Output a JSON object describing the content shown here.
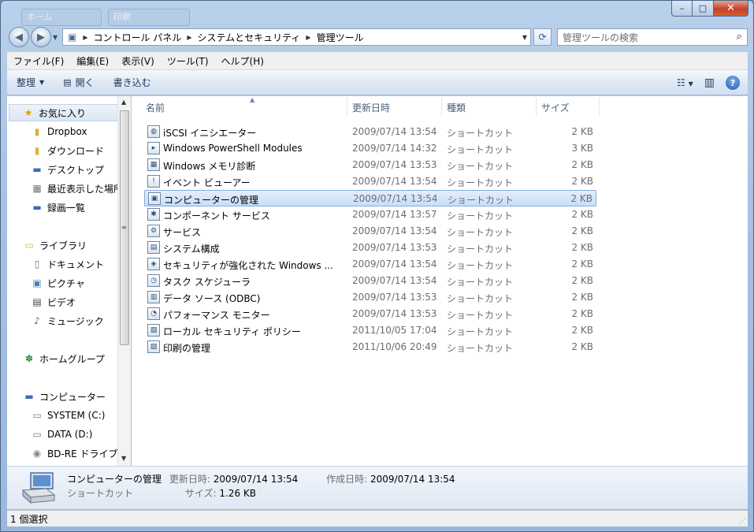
{
  "window": {
    "ghost_tabs": [
      "ホーム",
      "印刷"
    ],
    "caption": {
      "minimize": "–",
      "maximize": "□",
      "close": "✕"
    }
  },
  "address": {
    "crumbs": [
      "コントロール パネル",
      "システムとセキュリティ",
      "管理ツール"
    ],
    "search_placeholder": "管理ツールの検索"
  },
  "menu": [
    "ファイル(F)",
    "編集(E)",
    "表示(V)",
    "ツール(T)",
    "ヘルプ(H)"
  ],
  "commands": {
    "organize": "整理",
    "open": "開く",
    "burn": "書き込む"
  },
  "navigation": {
    "favorites": {
      "label": "お気に入り",
      "items": [
        "Dropbox",
        "ダウンロード",
        "デスクトップ",
        "最近表示した場所",
        "録画一覧"
      ]
    },
    "libraries": {
      "label": "ライブラリ",
      "items": [
        "ドキュメント",
        "ピクチャ",
        "ビデオ",
        "ミュージック"
      ]
    },
    "homegroup": {
      "label": "ホームグループ"
    },
    "computer": {
      "label": "コンピューター",
      "items": [
        "SYSTEM (C:)",
        "DATA (D:)",
        "BD-RE ドライブ"
      ]
    }
  },
  "columns": {
    "name": "名前",
    "date": "更新日時",
    "type": "種類",
    "size": "サイズ"
  },
  "files": [
    {
      "name": "iSCSI イニシエーター",
      "date": "2009/07/14 13:54",
      "type": "ショートカット",
      "size": "2 KB"
    },
    {
      "name": "Windows PowerShell Modules",
      "date": "2009/07/14 14:32",
      "type": "ショートカット",
      "size": "3 KB"
    },
    {
      "name": "Windows メモリ診断",
      "date": "2009/07/14 13:53",
      "type": "ショートカット",
      "size": "2 KB"
    },
    {
      "name": "イベント ビューアー",
      "date": "2009/07/14 13:54",
      "type": "ショートカット",
      "size": "2 KB"
    },
    {
      "name": "コンピューターの管理",
      "date": "2009/07/14 13:54",
      "type": "ショートカット",
      "size": "2 KB"
    },
    {
      "name": "コンポーネント サービス",
      "date": "2009/07/14 13:57",
      "type": "ショートカット",
      "size": "2 KB"
    },
    {
      "name": "サービス",
      "date": "2009/07/14 13:54",
      "type": "ショートカット",
      "size": "2 KB"
    },
    {
      "name": "システム構成",
      "date": "2009/07/14 13:53",
      "type": "ショートカット",
      "size": "2 KB"
    },
    {
      "name": "セキュリティが強化された Windows ...",
      "date": "2009/07/14 13:54",
      "type": "ショートカット",
      "size": "2 KB"
    },
    {
      "name": "タスク スケジューラ",
      "date": "2009/07/14 13:54",
      "type": "ショートカット",
      "size": "2 KB"
    },
    {
      "name": "データ ソース (ODBC)",
      "date": "2009/07/14 13:53",
      "type": "ショートカット",
      "size": "2 KB"
    },
    {
      "name": "パフォーマンス モニター",
      "date": "2009/07/14 13:53",
      "type": "ショートカット",
      "size": "2 KB"
    },
    {
      "name": "ローカル セキュリティ ポリシー",
      "date": "2011/10/05 17:04",
      "type": "ショートカット",
      "size": "2 KB"
    },
    {
      "name": "印刷の管理",
      "date": "2011/10/06 20:49",
      "type": "ショートカット",
      "size": "2 KB"
    }
  ],
  "details": {
    "name": "コンピューターの管理",
    "type": "ショートカット",
    "modified_label": "更新日時:",
    "modified": "2009/07/14 13:54",
    "created_label": "作成日時:",
    "created": "2009/07/14 13:54",
    "size_label": "サイズ:",
    "size": "1.26 KB"
  },
  "status": {
    "text": "1 個選択"
  }
}
